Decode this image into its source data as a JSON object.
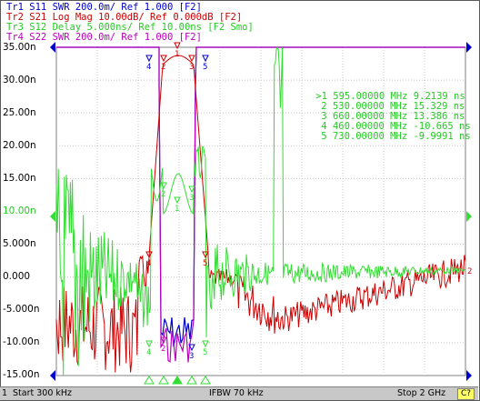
{
  "traces": [
    {
      "label": "Tr1 S11 SWR 200.0m/ Ref 1.000 [F2]",
      "color": "#0000cc"
    },
    {
      "label": "Tr2 S21 Log Mag 10.00dB/ Ref 0.000dB [F2]",
      "color": "#cc0000"
    },
    {
      "label": "Tr3 S12 Delay 5.000ns/ Ref 10.00ns [F2 Smo]",
      "color": "#22cc22"
    },
    {
      "label": "Tr4 S22 SWR 200.0m/ Ref 1.000 [F2]",
      "color": "#bb00bb"
    }
  ],
  "colors": {
    "blue": "#0000cc",
    "red": "#cc0000",
    "green": "#33dd33",
    "magenta": "#bb00bb",
    "grid": "#c8c8c8",
    "ref_marker": "#0000cc",
    "ref_marker_green": "#33dd33"
  },
  "y_axis_labels": [
    "35.00n",
    "30.00n",
    "25.00n",
    "20.00n",
    "15.00n",
    "10.00n",
    "5.000n",
    "0.000",
    "-5.000n",
    "-10.00n",
    "-15.00n"
  ],
  "markers": [
    {
      "id": ">1",
      "freq": "595.00000 MHz",
      "value": "9.2139 ns"
    },
    {
      "id": "2",
      "freq": "530.00000 MHz",
      "value": "15.329 ns"
    },
    {
      "id": "3",
      "freq": "660.00000 MHz",
      "value": "13.386 ns"
    },
    {
      "id": "4",
      "freq": "460.00000 MHz",
      "value": "-10.665 ns"
    },
    {
      "id": "5",
      "freq": "730.00000 MHz",
      "value": "-9.9991 ns"
    }
  ],
  "status": {
    "channel": "1",
    "start": "Start 300 kHz",
    "ifbw": "IFBW 70 kHz",
    "stop": "Stop 2 GHz",
    "cal": "C?"
  },
  "ref_right_label": "2",
  "marker_flags": [
    "1",
    "2",
    "3",
    "4",
    "5"
  ]
}
